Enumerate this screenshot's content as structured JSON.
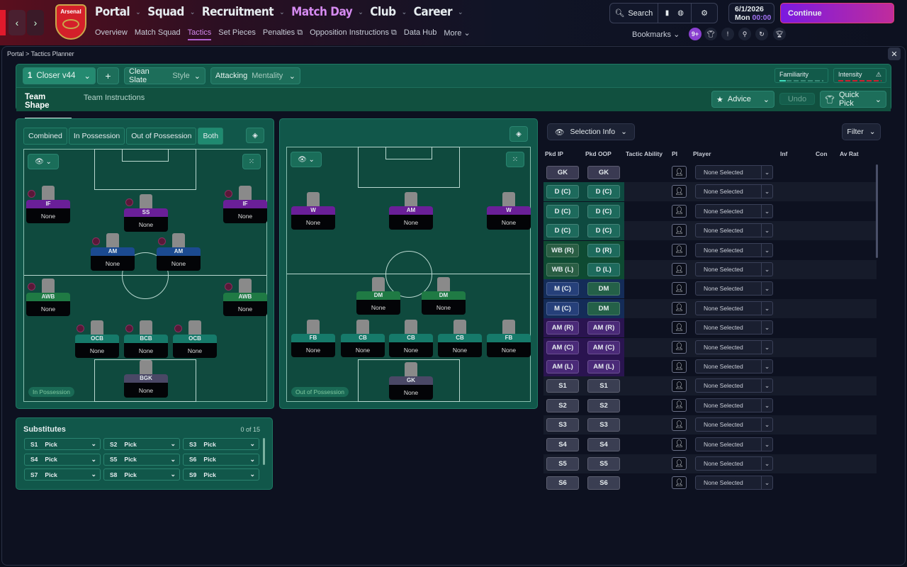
{
  "header": {
    "club": "Arsenal",
    "main_nav": [
      {
        "label": "Portal",
        "active": false
      },
      {
        "label": "Squad",
        "active": false
      },
      {
        "label": "Recruitment",
        "active": false
      },
      {
        "label": "Match Day",
        "active": true
      },
      {
        "label": "Club",
        "active": false
      },
      {
        "label": "Career",
        "active": false
      }
    ],
    "sub_nav": [
      {
        "label": "Overview"
      },
      {
        "label": "Match Squad"
      },
      {
        "label": "Tactics",
        "active": true
      },
      {
        "label": "Set Pieces"
      },
      {
        "label": "Penalties",
        "external": true
      },
      {
        "label": "Opposition Instructions",
        "external": true
      },
      {
        "label": "Data Hub"
      },
      {
        "label": "More ⌄"
      }
    ],
    "search_label": "Search",
    "date": "6/1/2026",
    "day": "Mon",
    "time": "00:00",
    "continue_label": "Continue",
    "bookmarks_label": "Bookmarks",
    "inbox_badge": "9+"
  },
  "breadcrumb": {
    "root": "Portal",
    "current": "Tactics Planner"
  },
  "tactic": {
    "number": "1",
    "name": "Closer v44",
    "style": "Clean Slate",
    "style_label": "Style",
    "mentality": "Attacking",
    "mentality_label": "Mentality",
    "familiarity_label": "Familiarity",
    "familiarity_level": 0.14,
    "intensity_label": "Intensity",
    "tabs": [
      {
        "label": "Team Shape",
        "active": true
      },
      {
        "label": "Team Instructions"
      }
    ],
    "advice_label": "Advice",
    "undo_label": "Undo",
    "quick_pick_label": "Quick Pick"
  },
  "view_toggle": [
    "Combined",
    "In Possession",
    "Out of Possession",
    "Both"
  ],
  "view_selected": "Both",
  "in_possession": {
    "label": "In Possession",
    "players": [
      {
        "role": "IF",
        "name": "None",
        "color": "#6a1f98"
      },
      {
        "role": "SS",
        "name": "None",
        "color": "#6a1f98"
      },
      {
        "role": "IF",
        "name": "None",
        "color": "#6a1f98"
      },
      {
        "role": "AM",
        "name": "None",
        "color": "#1b4a90"
      },
      {
        "role": "AM",
        "name": "None",
        "color": "#1b4a90"
      },
      {
        "role": "AWB",
        "name": "None",
        "color": "#1f7a44"
      },
      {
        "role": "AWB",
        "name": "None",
        "color": "#1f7a44"
      },
      {
        "role": "OCB",
        "name": "None",
        "color": "#167a6a"
      },
      {
        "role": "BCB",
        "name": "None",
        "color": "#167a6a"
      },
      {
        "role": "OCB",
        "name": "None",
        "color": "#167a6a"
      },
      {
        "role": "BGK",
        "name": "None",
        "color": "#4a4866"
      }
    ]
  },
  "out_of_possession": {
    "label": "Out of Possession",
    "players": [
      {
        "role": "W",
        "name": "None",
        "color": "#6a1f98"
      },
      {
        "role": "AM",
        "name": "None",
        "color": "#6a1f98"
      },
      {
        "role": "W",
        "name": "None",
        "color": "#6a1f98"
      },
      {
        "role": "DM",
        "name": "None",
        "color": "#1f7a44"
      },
      {
        "role": "DM",
        "name": "None",
        "color": "#1f7a44"
      },
      {
        "role": "FB",
        "name": "None",
        "color": "#167a6a"
      },
      {
        "role": "CB",
        "name": "None",
        "color": "#167a6a"
      },
      {
        "role": "CB",
        "name": "None",
        "color": "#167a6a"
      },
      {
        "role": "CB",
        "name": "None",
        "color": "#167a6a"
      },
      {
        "role": "FB",
        "name": "None",
        "color": "#167a6a"
      },
      {
        "role": "GK",
        "name": "None",
        "color": "#4a4866"
      }
    ]
  },
  "substitutes": {
    "title": "Substitutes",
    "count": "0 of 15",
    "slots": [
      {
        "slot": "S1",
        "value": "Pick"
      },
      {
        "slot": "S2",
        "value": "Pick"
      },
      {
        "slot": "S3",
        "value": "Pick"
      },
      {
        "slot": "S4",
        "value": "Pick"
      },
      {
        "slot": "S5",
        "value": "Pick"
      },
      {
        "slot": "S6",
        "value": "Pick"
      },
      {
        "slot": "S7",
        "value": "Pick"
      },
      {
        "slot": "S8",
        "value": "Pick"
      },
      {
        "slot": "S9",
        "value": "Pick"
      }
    ]
  },
  "selection": {
    "info_label": "Selection Info",
    "filter_label": "Filter",
    "columns": [
      "Pkd IP",
      "Pkd OOP",
      "Tactic Ability",
      "PI",
      "Player",
      "Inf",
      "Con",
      "Av Rat"
    ],
    "rows": [
      {
        "ip": "GK",
        "oop": "GK",
        "player": "None Selected",
        "group": "gk"
      },
      {
        "ip": "D (C)",
        "oop": "D (C)",
        "player": "None Selected",
        "group": "d"
      },
      {
        "ip": "D (C)",
        "oop": "D (C)",
        "player": "None Selected",
        "group": "d"
      },
      {
        "ip": "D (C)",
        "oop": "D (C)",
        "player": "None Selected",
        "group": "d"
      },
      {
        "ip": "WB (R)",
        "oop": "D (R)",
        "player": "None Selected",
        "group": "wb"
      },
      {
        "ip": "WB (L)",
        "oop": "D (L)",
        "player": "None Selected",
        "group": "wb"
      },
      {
        "ip": "M (C)",
        "oop": "DM",
        "player": "None Selected",
        "group": "m"
      },
      {
        "ip": "M (C)",
        "oop": "DM",
        "player": "None Selected",
        "group": "m"
      },
      {
        "ip": "AM (R)",
        "oop": "AM (R)",
        "player": "None Selected",
        "group": "am"
      },
      {
        "ip": "AM (C)",
        "oop": "AM (C)",
        "player": "None Selected",
        "group": "am"
      },
      {
        "ip": "AM (L)",
        "oop": "AM (L)",
        "player": "None Selected",
        "group": "am"
      },
      {
        "ip": "S1",
        "oop": "S1",
        "player": "None Selected",
        "group": "s"
      },
      {
        "ip": "S2",
        "oop": "S2",
        "player": "None Selected",
        "group": "s"
      },
      {
        "ip": "S3",
        "oop": "S3",
        "player": "None Selected",
        "group": "s"
      },
      {
        "ip": "S4",
        "oop": "S4",
        "player": "None Selected",
        "group": "s"
      },
      {
        "ip": "S5",
        "oop": "S5",
        "player": "None Selected",
        "group": "s"
      },
      {
        "ip": "S6",
        "oop": "S6",
        "player": "None Selected",
        "group": "s"
      }
    ]
  },
  "colors": {
    "accent": "#b060d0",
    "continue_start": "#7b1ae0",
    "continue_end": "#c02c9c",
    "pitch": "#0f4a3e",
    "panel": "#11574a"
  }
}
